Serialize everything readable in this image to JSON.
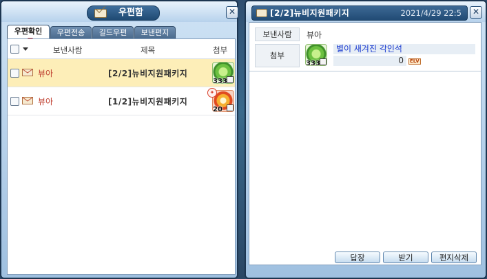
{
  "mailbox": {
    "title": "우편함",
    "tabs": [
      {
        "label": "우편확인",
        "active": true
      },
      {
        "label": "우편전송",
        "active": false
      },
      {
        "label": "길드우편",
        "active": false
      },
      {
        "label": "보낸편지",
        "active": false
      }
    ],
    "columns": {
      "sender": "보낸사람",
      "subject": "제목",
      "attachment": "첨부"
    },
    "rows": [
      {
        "sender": "뷰아",
        "subject": "[2/2]뉴비지원패키지",
        "qty": "333",
        "selected": true
      },
      {
        "sender": "뷰아",
        "subject": "[1/2]뉴비지원패키지",
        "qty": "20",
        "selected": false
      }
    ]
  },
  "detail": {
    "subject": "[2/2]뉴비지원패키지",
    "date": "2021/4/29 22:5",
    "sender_label": "보낸사람",
    "sender": "뷰아",
    "attach_label": "첨부",
    "attachment": {
      "name": "별이 새겨진 각인석",
      "qty": "333",
      "price": "0",
      "tag": "ELV"
    },
    "buttons": {
      "reply": "답장",
      "receive": "받기",
      "delete": "편지삭제"
    }
  },
  "colors": {
    "selected_row": "#fdeeb8",
    "sender_text": "#c04030",
    "item_name": "#1a3ad0"
  }
}
